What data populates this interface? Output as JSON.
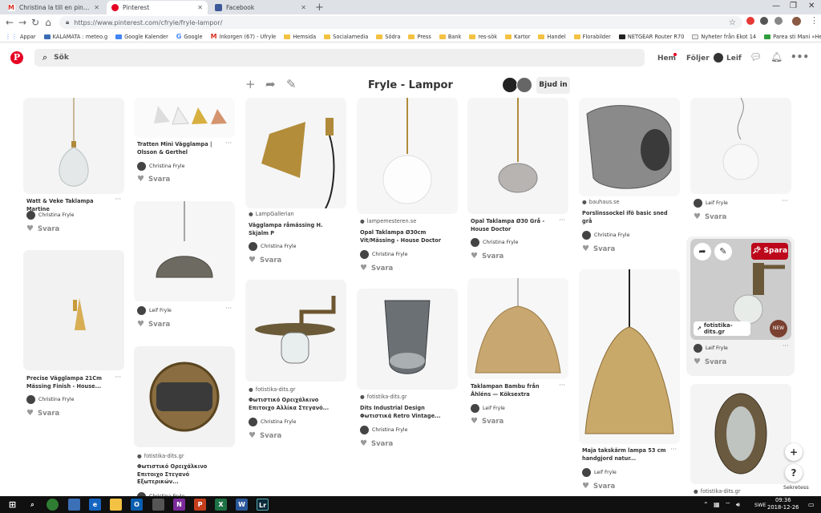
{
  "browser": {
    "tabs": [
      {
        "title": "Christina la till en pin på Fryle - …",
        "icon": "gmail-icon",
        "color": "#d93025"
      },
      {
        "title": "Pinterest",
        "icon": "pinterest-icon",
        "color": "#e60023"
      },
      {
        "title": "Facebook",
        "icon": "facebook-icon",
        "color": "#3b5998"
      }
    ],
    "url": "https://www.pinterest.com/cfryle/fryle-lampor/",
    "bookmarks": [
      "Appar",
      "KALAMATA : meteo.g",
      "Google Kalender",
      "Google",
      "Inkorgen (67) - Ufryle",
      "Hemsida",
      "Socialamedia",
      "Södra",
      "Press",
      "Bank",
      "res-sök",
      "Kartor",
      "Handel",
      "Florabilder",
      "NETGEAR Router R70",
      "Nyheter från Ekot 14",
      "Parea sti Mani »Hem"
    ]
  },
  "header": {
    "search_placeholder": "Sök",
    "nav": [
      "Hem",
      "Följer",
      "Leif"
    ]
  },
  "board": {
    "title": "Fryle - Lampor",
    "invite": "Bjud in"
  },
  "pins": [
    {
      "title": "Watt & Veke Taklampa Martine",
      "user": "Christina Fryle",
      "action": "Svara"
    },
    {
      "title": "Precise Vägglampa 21Cm Mässing Finish - House...",
      "user": "Christina Fryle",
      "action": "Svara"
    },
    {
      "title": "Tratten Mini Vägglampa | Olsson & Gerthel",
      "user": "Christina Fryle",
      "action": "Svara"
    },
    {
      "title": "",
      "user": "Leif Fryle",
      "action": "Svara"
    },
    {
      "source": "fotistika-dits.gr",
      "title": "Φωτιστικό Ορειχάλκινο Επιτοιχο Στεγανό Εξωτερικών...",
      "user": "Christina Fryle"
    },
    {
      "source": "LampGallerian",
      "title": "Vägglampa råmässing H. Skjalm P",
      "user": "Christina Fryle",
      "action": "Svara"
    },
    {
      "source": "fotistika-dits.gr",
      "title": "Φωτιστικό Ορειχάλκινο Επιτοιχο Αλλίκα Στεγανό...",
      "user": "Christina Fryle",
      "action": "Svara"
    },
    {
      "source": "lampemesteren.se",
      "title": "Opal Taklampa Ø30cm Vit/Mässing - House Doctor",
      "user": "Christina Fryle",
      "action": "Svara"
    },
    {
      "source": "fotistika-dits.gr",
      "title": "Dits Industrial Design Φωτιστικά Retro Vintage...",
      "user": "Christina Fryle",
      "action": "Svara"
    },
    {
      "title": "Opal Taklampa Ø30 Grå - House Doctor",
      "user": "Christina Fryle",
      "action": "Svara"
    },
    {
      "title": "Taklampan Bambu från Åhléns — Köksextra",
      "user": "Leif Fryle",
      "action": "Svara"
    },
    {
      "source": "bauhaus.se",
      "title": "Porslinssockel ifö basic sned grå",
      "user": "Christina Fryle",
      "action": "Svara"
    },
    {
      "title": "Maja takskärm lampa 53 cm handgjord natur...",
      "user": "Leif Fryle",
      "action": "Svara"
    },
    {
      "title": "",
      "user": "Leif Fryle",
      "action": "Svara"
    },
    {
      "title": "",
      "user": "Leif Fryle",
      "action": "Svara",
      "link": "fotistika-dits.gr",
      "save": "Spara",
      "badge": "NEW"
    },
    {
      "source": "fotistika-dits.gr"
    }
  ],
  "misc": {
    "sekretess": "Sekretess",
    "lang": "SWE",
    "time": "09:36",
    "date": "2018-12-26"
  },
  "colors": {
    "brand_red": "#e60023",
    "save_red": "#bd081c"
  }
}
